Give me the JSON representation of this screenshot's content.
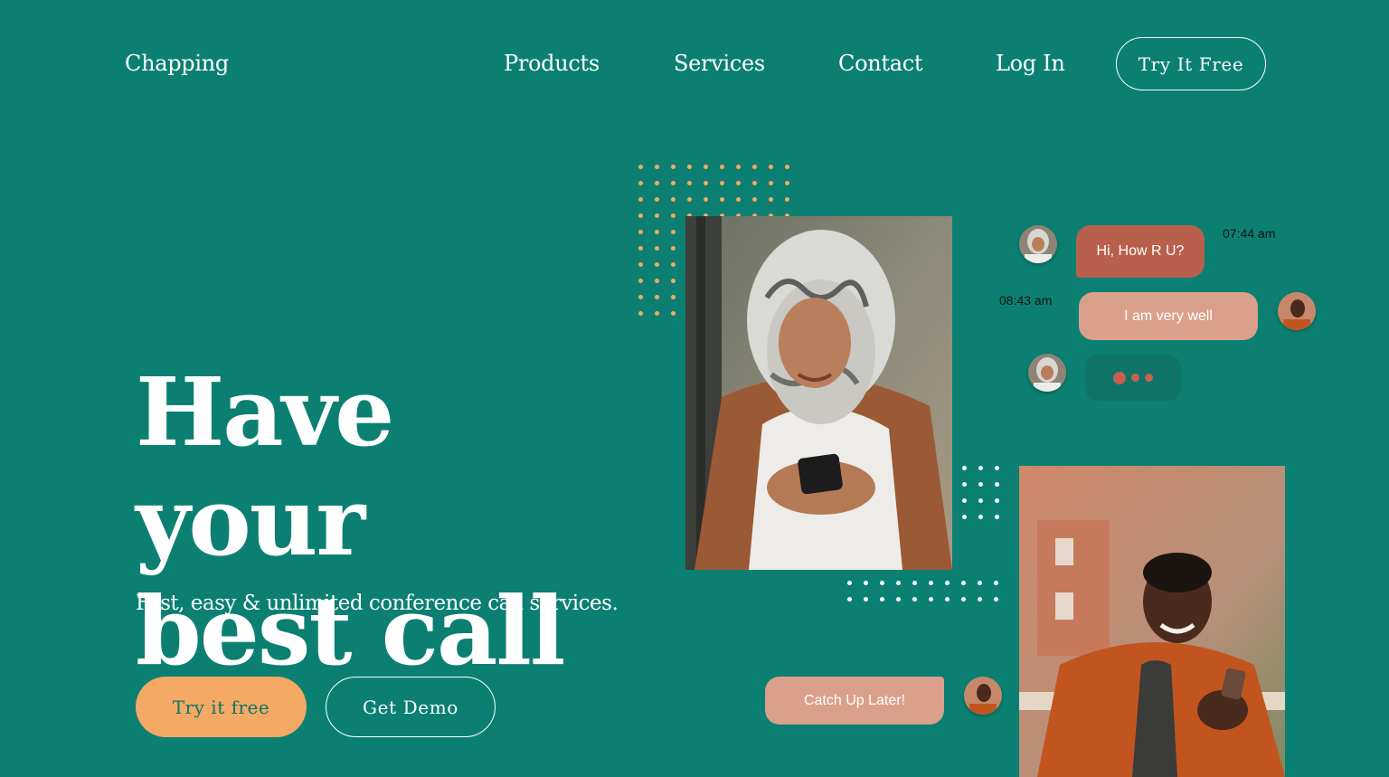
{
  "nav": {
    "brand": "Chapping",
    "links": [
      "Products",
      "Services",
      "Contact",
      "Log In"
    ],
    "cta": "Try It Free"
  },
  "hero": {
    "title_line1": "Have your",
    "title_line2": "best call",
    "subtitle": "Fast, easy & unlimited conference call services.",
    "primary_button": "Try it free",
    "secondary_button": "Get Demo"
  },
  "chat": {
    "message_1": {
      "text": "Hi, How R U?",
      "time": "07:44 am"
    },
    "message_2": {
      "text": "I am very well",
      "time": "08:43 am"
    },
    "message_3": {
      "text": "Catch Up Later!"
    },
    "typing_indicator": "typing"
  },
  "colors": {
    "background": "#0b8072",
    "accent_orange": "#f4a964",
    "bubble_dark": "#b8604c",
    "bubble_light": "#dba08c"
  }
}
